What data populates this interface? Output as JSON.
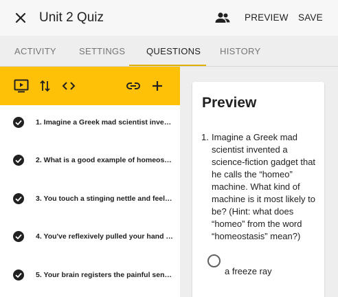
{
  "header": {
    "title": "Unit 2 Quiz",
    "close_icon": "close-icon",
    "people_icon": "people-icon",
    "preview_label": "PREVIEW",
    "save_label": "SAVE"
  },
  "tabs": [
    {
      "label": "ACTIVITY",
      "active": false
    },
    {
      "label": "SETTINGS",
      "active": false
    },
    {
      "label": "QUESTIONS",
      "active": true
    },
    {
      "label": "HISTORY",
      "active": false
    }
  ],
  "toolbar": {
    "icons": [
      "preview-media-icon",
      "reorder-icon",
      "embed-code-icon",
      "link-icon",
      "add-icon"
    ],
    "color": "#ffc107"
  },
  "questions": [
    {
      "text": "1. Imagine a Greek mad scientist invent..."
    },
    {
      "text": "2. What is a good example of homeosta..."
    },
    {
      "text": "3. You touch a stinging nettle and feel a..."
    },
    {
      "text": "4. You've reflexively pulled your hand b..."
    },
    {
      "text": "5. Your brain registers the painful sensa..."
    }
  ],
  "preview": {
    "title": "Preview",
    "question_number": "1.",
    "question_text": "Imagine a Greek mad scientist invented a science-fiction gadget that he calls the “homeo” machine. What kind of machine is it most likely to be? (Hint: what does “homeo” from the word “homeostasis” mean?)",
    "answer": "a freeze ray"
  }
}
